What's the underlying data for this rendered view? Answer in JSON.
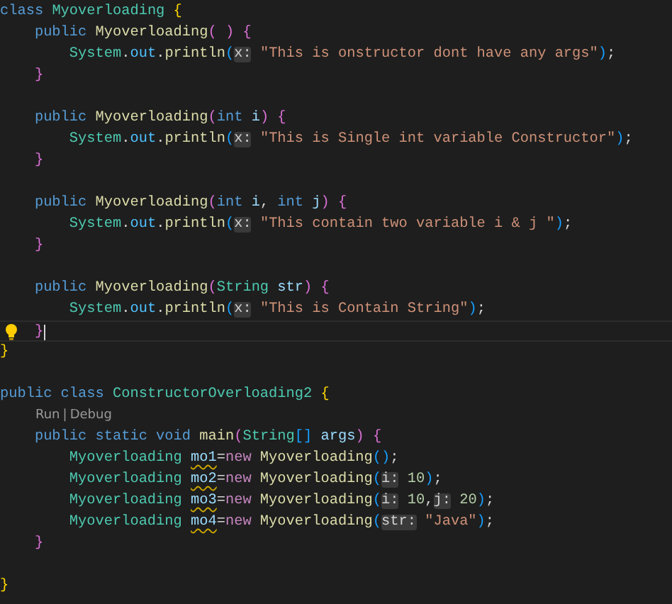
{
  "editor": {
    "lines": [
      {
        "tokens": [
          {
            "text": "class",
            "kind": "kw"
          },
          {
            "text": " Myoverloading",
            "kind": "type"
          },
          {
            "text": " {",
            "kind": "b1"
          }
        ]
      },
      {
        "tokens": [
          {
            "text": "    public",
            "kind": "kw"
          },
          {
            "text": " Myoverloading",
            "kind": "fn"
          },
          {
            "text": "(",
            "kind": "b2"
          },
          {
            "text": " )",
            "kind": "b2"
          },
          {
            "text": " {",
            "kind": "b2"
          }
        ]
      },
      {
        "tokens": [
          {
            "text": "        System",
            "kind": "type"
          },
          {
            "text": ".",
            "kind": "p"
          },
          {
            "text": "out",
            "kind": "prop"
          },
          {
            "text": ".",
            "kind": "p"
          },
          {
            "text": "println",
            "kind": "fn"
          },
          {
            "text": "(",
            "kind": "b3"
          },
          {
            "text": "x:",
            "kind": "hint"
          },
          {
            "text": " \"This is onstructor dont have any args\"",
            "kind": "str"
          },
          {
            "text": ")",
            "kind": "b3"
          },
          {
            "text": ";",
            "kind": "p"
          }
        ]
      },
      {
        "tokens": [
          {
            "text": "    }",
            "kind": "b2"
          }
        ]
      },
      {
        "kind": "blank"
      },
      {
        "tokens": [
          {
            "text": "    public",
            "kind": "kw"
          },
          {
            "text": " Myoverloading",
            "kind": "fn"
          },
          {
            "text": "(",
            "kind": "b2"
          },
          {
            "text": "int",
            "kind": "kw"
          },
          {
            "text": " i",
            "kind": "var"
          },
          {
            "text": ")",
            "kind": "b2"
          },
          {
            "text": " {",
            "kind": "b2"
          }
        ]
      },
      {
        "tokens": [
          {
            "text": "        System",
            "kind": "type"
          },
          {
            "text": ".",
            "kind": "p"
          },
          {
            "text": "out",
            "kind": "prop"
          },
          {
            "text": ".",
            "kind": "p"
          },
          {
            "text": "println",
            "kind": "fn"
          },
          {
            "text": "(",
            "kind": "b3"
          },
          {
            "text": "x:",
            "kind": "hint"
          },
          {
            "text": " \"This is Single int variable Constructor\"",
            "kind": "str"
          },
          {
            "text": ")",
            "kind": "b3"
          },
          {
            "text": ";",
            "kind": "p"
          }
        ]
      },
      {
        "tokens": [
          {
            "text": "    }",
            "kind": "b2"
          }
        ]
      },
      {
        "kind": "blank"
      },
      {
        "tokens": [
          {
            "text": "    public",
            "kind": "kw"
          },
          {
            "text": " Myoverloading",
            "kind": "fn"
          },
          {
            "text": "(",
            "kind": "b2"
          },
          {
            "text": "int",
            "kind": "kw"
          },
          {
            "text": " i",
            "kind": "var"
          },
          {
            "text": ",",
            "kind": "p"
          },
          {
            "text": " int",
            "kind": "kw"
          },
          {
            "text": " j",
            "kind": "var"
          },
          {
            "text": ")",
            "kind": "b2"
          },
          {
            "text": " {",
            "kind": "b2"
          }
        ]
      },
      {
        "tokens": [
          {
            "text": "        System",
            "kind": "type"
          },
          {
            "text": ".",
            "kind": "p"
          },
          {
            "text": "out",
            "kind": "prop"
          },
          {
            "text": ".",
            "kind": "p"
          },
          {
            "text": "println",
            "kind": "fn"
          },
          {
            "text": "(",
            "kind": "b3"
          },
          {
            "text": "x:",
            "kind": "hint"
          },
          {
            "text": " \"This contain two variable i & j \"",
            "kind": "str"
          },
          {
            "text": ")",
            "kind": "b3"
          },
          {
            "text": ";",
            "kind": "p"
          }
        ]
      },
      {
        "tokens": [
          {
            "text": "    }",
            "kind": "b2"
          }
        ]
      },
      {
        "kind": "blank"
      },
      {
        "tokens": [
          {
            "text": "    public",
            "kind": "kw"
          },
          {
            "text": " Myoverloading",
            "kind": "fn"
          },
          {
            "text": "(",
            "kind": "b2"
          },
          {
            "text": "String",
            "kind": "type"
          },
          {
            "text": " str",
            "kind": "var"
          },
          {
            "text": ")",
            "kind": "b2"
          },
          {
            "text": " {",
            "kind": "b2"
          }
        ]
      },
      {
        "tokens": [
          {
            "text": "        System",
            "kind": "type"
          },
          {
            "text": ".",
            "kind": "p"
          },
          {
            "text": "out",
            "kind": "prop"
          },
          {
            "text": ".",
            "kind": "p"
          },
          {
            "text": "println",
            "kind": "fn"
          },
          {
            "text": "(",
            "kind": "b3"
          },
          {
            "text": "x:",
            "kind": "hint"
          },
          {
            "text": " \"This is Contain String\"",
            "kind": "str"
          },
          {
            "text": ")",
            "kind": "b3"
          },
          {
            "text": ";",
            "kind": "p"
          }
        ]
      },
      {
        "current": true,
        "lightbulb": true,
        "tokens": [
          {
            "text": "    }",
            "kind": "b2"
          }
        ]
      },
      {
        "tokens": [
          {
            "text": "}",
            "kind": "b1"
          }
        ]
      },
      {
        "kind": "blank"
      },
      {
        "tokens": [
          {
            "text": "public",
            "kind": "kw"
          },
          {
            "text": " class",
            "kind": "kw"
          },
          {
            "text": " ConstructorOverloading2",
            "kind": "type"
          },
          {
            "text": " {",
            "kind": "b1"
          }
        ]
      },
      {
        "kind": "codelens",
        "tokens": [
          {
            "text": "Run",
            "kind": "link"
          },
          {
            "text": "|",
            "kind": "sep"
          },
          {
            "text": "Debug",
            "kind": "link"
          }
        ]
      },
      {
        "tokens": [
          {
            "text": "    public",
            "kind": "kw"
          },
          {
            "text": " static",
            "kind": "kw"
          },
          {
            "text": " void",
            "kind": "kw"
          },
          {
            "text": " main",
            "kind": "fn"
          },
          {
            "text": "(",
            "kind": "b2"
          },
          {
            "text": "String",
            "kind": "type"
          },
          {
            "text": "[]",
            "kind": "b3"
          },
          {
            "text": " args",
            "kind": "var"
          },
          {
            "text": ")",
            "kind": "b2"
          },
          {
            "text": " {",
            "kind": "b2"
          }
        ]
      },
      {
        "tokens": [
          {
            "text": "        Myoverloading ",
            "kind": "type"
          },
          {
            "text": "mo1",
            "kind": "warn"
          },
          {
            "text": "=",
            "kind": "p"
          },
          {
            "text": "new",
            "kind": "ctrl"
          },
          {
            "text": " Myoverloading",
            "kind": "fn"
          },
          {
            "text": "(",
            "kind": "b3"
          },
          {
            "text": ")",
            "kind": "b3"
          },
          {
            "text": ";",
            "kind": "p"
          }
        ]
      },
      {
        "tokens": [
          {
            "text": "        Myoverloading ",
            "kind": "type"
          },
          {
            "text": "mo2",
            "kind": "warn"
          },
          {
            "text": "=",
            "kind": "p"
          },
          {
            "text": "new",
            "kind": "ctrl"
          },
          {
            "text": " Myoverloading",
            "kind": "fn"
          },
          {
            "text": "(",
            "kind": "b3"
          },
          {
            "text": "i:",
            "kind": "hint"
          },
          {
            "text": " 10",
            "kind": "num"
          },
          {
            "text": ")",
            "kind": "b3"
          },
          {
            "text": ";",
            "kind": "p"
          }
        ]
      },
      {
        "tokens": [
          {
            "text": "        Myoverloading ",
            "kind": "type"
          },
          {
            "text": "mo3",
            "kind": "warn"
          },
          {
            "text": "=",
            "kind": "p"
          },
          {
            "text": "new",
            "kind": "ctrl"
          },
          {
            "text": " Myoverloading",
            "kind": "fn"
          },
          {
            "text": "(",
            "kind": "b3"
          },
          {
            "text": "i:",
            "kind": "hint"
          },
          {
            "text": " 10",
            "kind": "num"
          },
          {
            "text": ",",
            "kind": "p"
          },
          {
            "text": "j:",
            "kind": "hint"
          },
          {
            "text": " 20",
            "kind": "num"
          },
          {
            "text": ")",
            "kind": "b3"
          },
          {
            "text": ";",
            "kind": "p"
          }
        ]
      },
      {
        "tokens": [
          {
            "text": "        Myoverloading ",
            "kind": "type"
          },
          {
            "text": "mo4",
            "kind": "warn"
          },
          {
            "text": "=",
            "kind": "p"
          },
          {
            "text": "new",
            "kind": "ctrl"
          },
          {
            "text": " Myoverloading",
            "kind": "fn"
          },
          {
            "text": "(",
            "kind": "b3"
          },
          {
            "text": "str:",
            "kind": "hint"
          },
          {
            "text": " \"Java\"",
            "kind": "str"
          },
          {
            "text": ")",
            "kind": "b3"
          },
          {
            "text": ";",
            "kind": "p"
          }
        ]
      },
      {
        "tokens": [
          {
            "text": "    }",
            "kind": "b2"
          }
        ]
      },
      {
        "kind": "blank"
      },
      {
        "tokens": [
          {
            "text": "}",
            "kind": "b1"
          }
        ]
      }
    ]
  }
}
